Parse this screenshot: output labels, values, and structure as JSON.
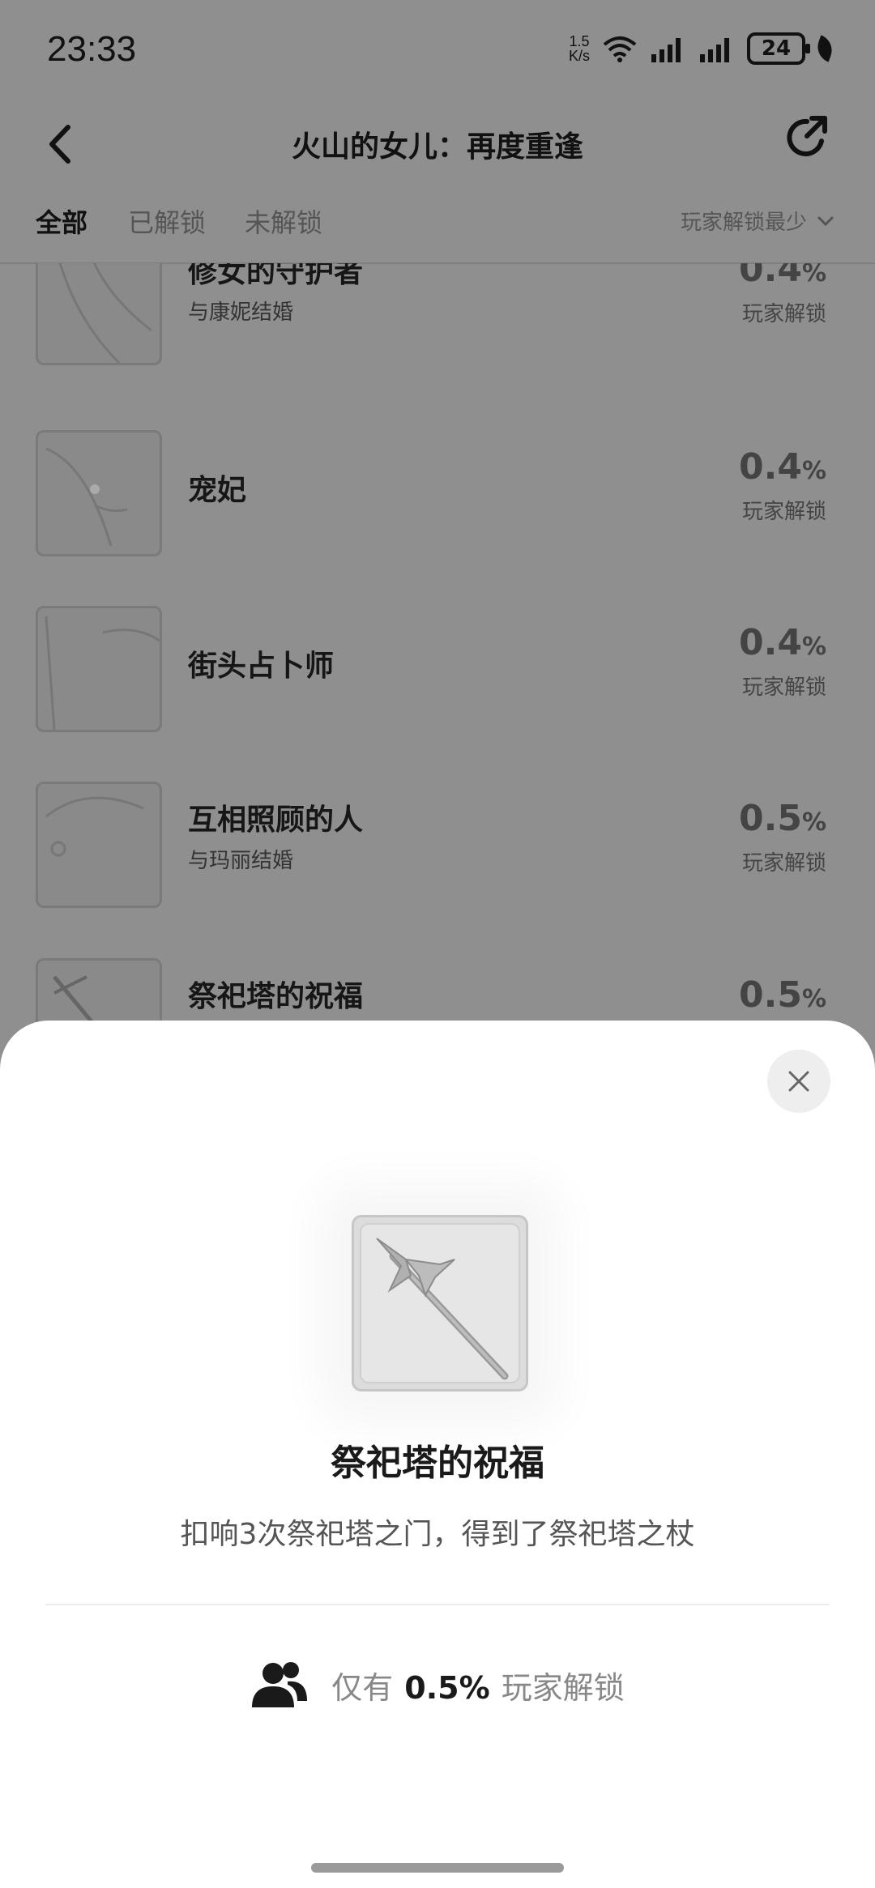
{
  "status": {
    "time": "23:33",
    "net_speed_value": "1.5",
    "net_speed_unit": "K/s",
    "battery": "24"
  },
  "header": {
    "title": "火山的女儿：再度重逢"
  },
  "tabs": {
    "all": "全部",
    "unlocked": "已解锁",
    "locked": "未解锁",
    "sort": "玩家解锁最少"
  },
  "list": [
    {
      "title": "修女的守护者",
      "sub": "与康妮结婚",
      "pct": "0.4",
      "unit": "%",
      "label": "玩家解锁"
    },
    {
      "title": "宠妃",
      "sub": "",
      "pct": "0.4",
      "unit": "%",
      "label": "玩家解锁"
    },
    {
      "title": "街头占卜师",
      "sub": "",
      "pct": "0.4",
      "unit": "%",
      "label": "玩家解锁"
    },
    {
      "title": "互相照顾的人",
      "sub": "与玛丽结婚",
      "pct": "0.5",
      "unit": "%",
      "label": "玩家解锁"
    },
    {
      "title": "祭祀塔的祝福",
      "sub": "",
      "pct": "0.5",
      "unit": "%",
      "label": ""
    }
  ],
  "sheet": {
    "title": "祭祀塔的祝福",
    "desc": "扣响3次祭祀塔之门，得到了祭祀塔之杖",
    "stat_prefix": "仅有",
    "stat_value": "0.5%",
    "stat_suffix": "玩家解锁"
  }
}
